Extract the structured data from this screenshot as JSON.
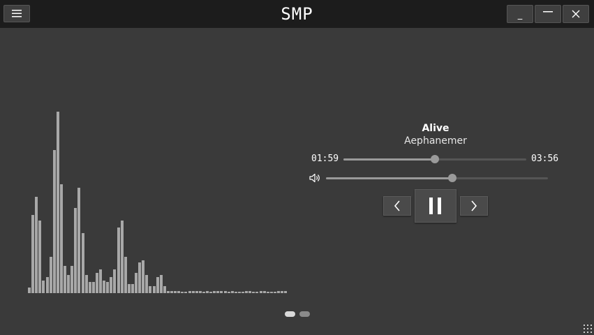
{
  "app": {
    "title": "SMP"
  },
  "colors": {
    "titlebar": "#1c1c1c",
    "background": "#3a3a3a",
    "bars": "#a8a8a8",
    "accent": "#9a9a9a"
  },
  "icons": [
    "menu-icon",
    "minimize-icon",
    "maximize-icon",
    "close-icon",
    "volume-icon",
    "previous-icon",
    "pause-icon",
    "next-icon",
    "resize-grip-icon"
  ],
  "window_buttons": {
    "minimize": "_"
  },
  "track": {
    "title": "Alive",
    "artist": "Aephanemer"
  },
  "playback": {
    "elapsed": "01:59",
    "duration": "03:56",
    "progress": 0.5,
    "volume": 0.57,
    "state": "playing"
  },
  "visualizer": {
    "levels": [
      3,
      43,
      53,
      40,
      7,
      9,
      20,
      79,
      100,
      60,
      15,
      10,
      15,
      47,
      58,
      33,
      10,
      6,
      6,
      11,
      13,
      7,
      6,
      9,
      13,
      36,
      40,
      20,
      5,
      5,
      11,
      17,
      18,
      10,
      4,
      4,
      9,
      10,
      4,
      1,
      1,
      1,
      1,
      0,
      0,
      1,
      1,
      1,
      1,
      0,
      1,
      0,
      1,
      1,
      1,
      1,
      0,
      1,
      0,
      0,
      0,
      1,
      1,
      0,
      0,
      1,
      1,
      0,
      0,
      0,
      1,
      1,
      1
    ]
  },
  "pager": {
    "pages": 2,
    "active": 0
  }
}
